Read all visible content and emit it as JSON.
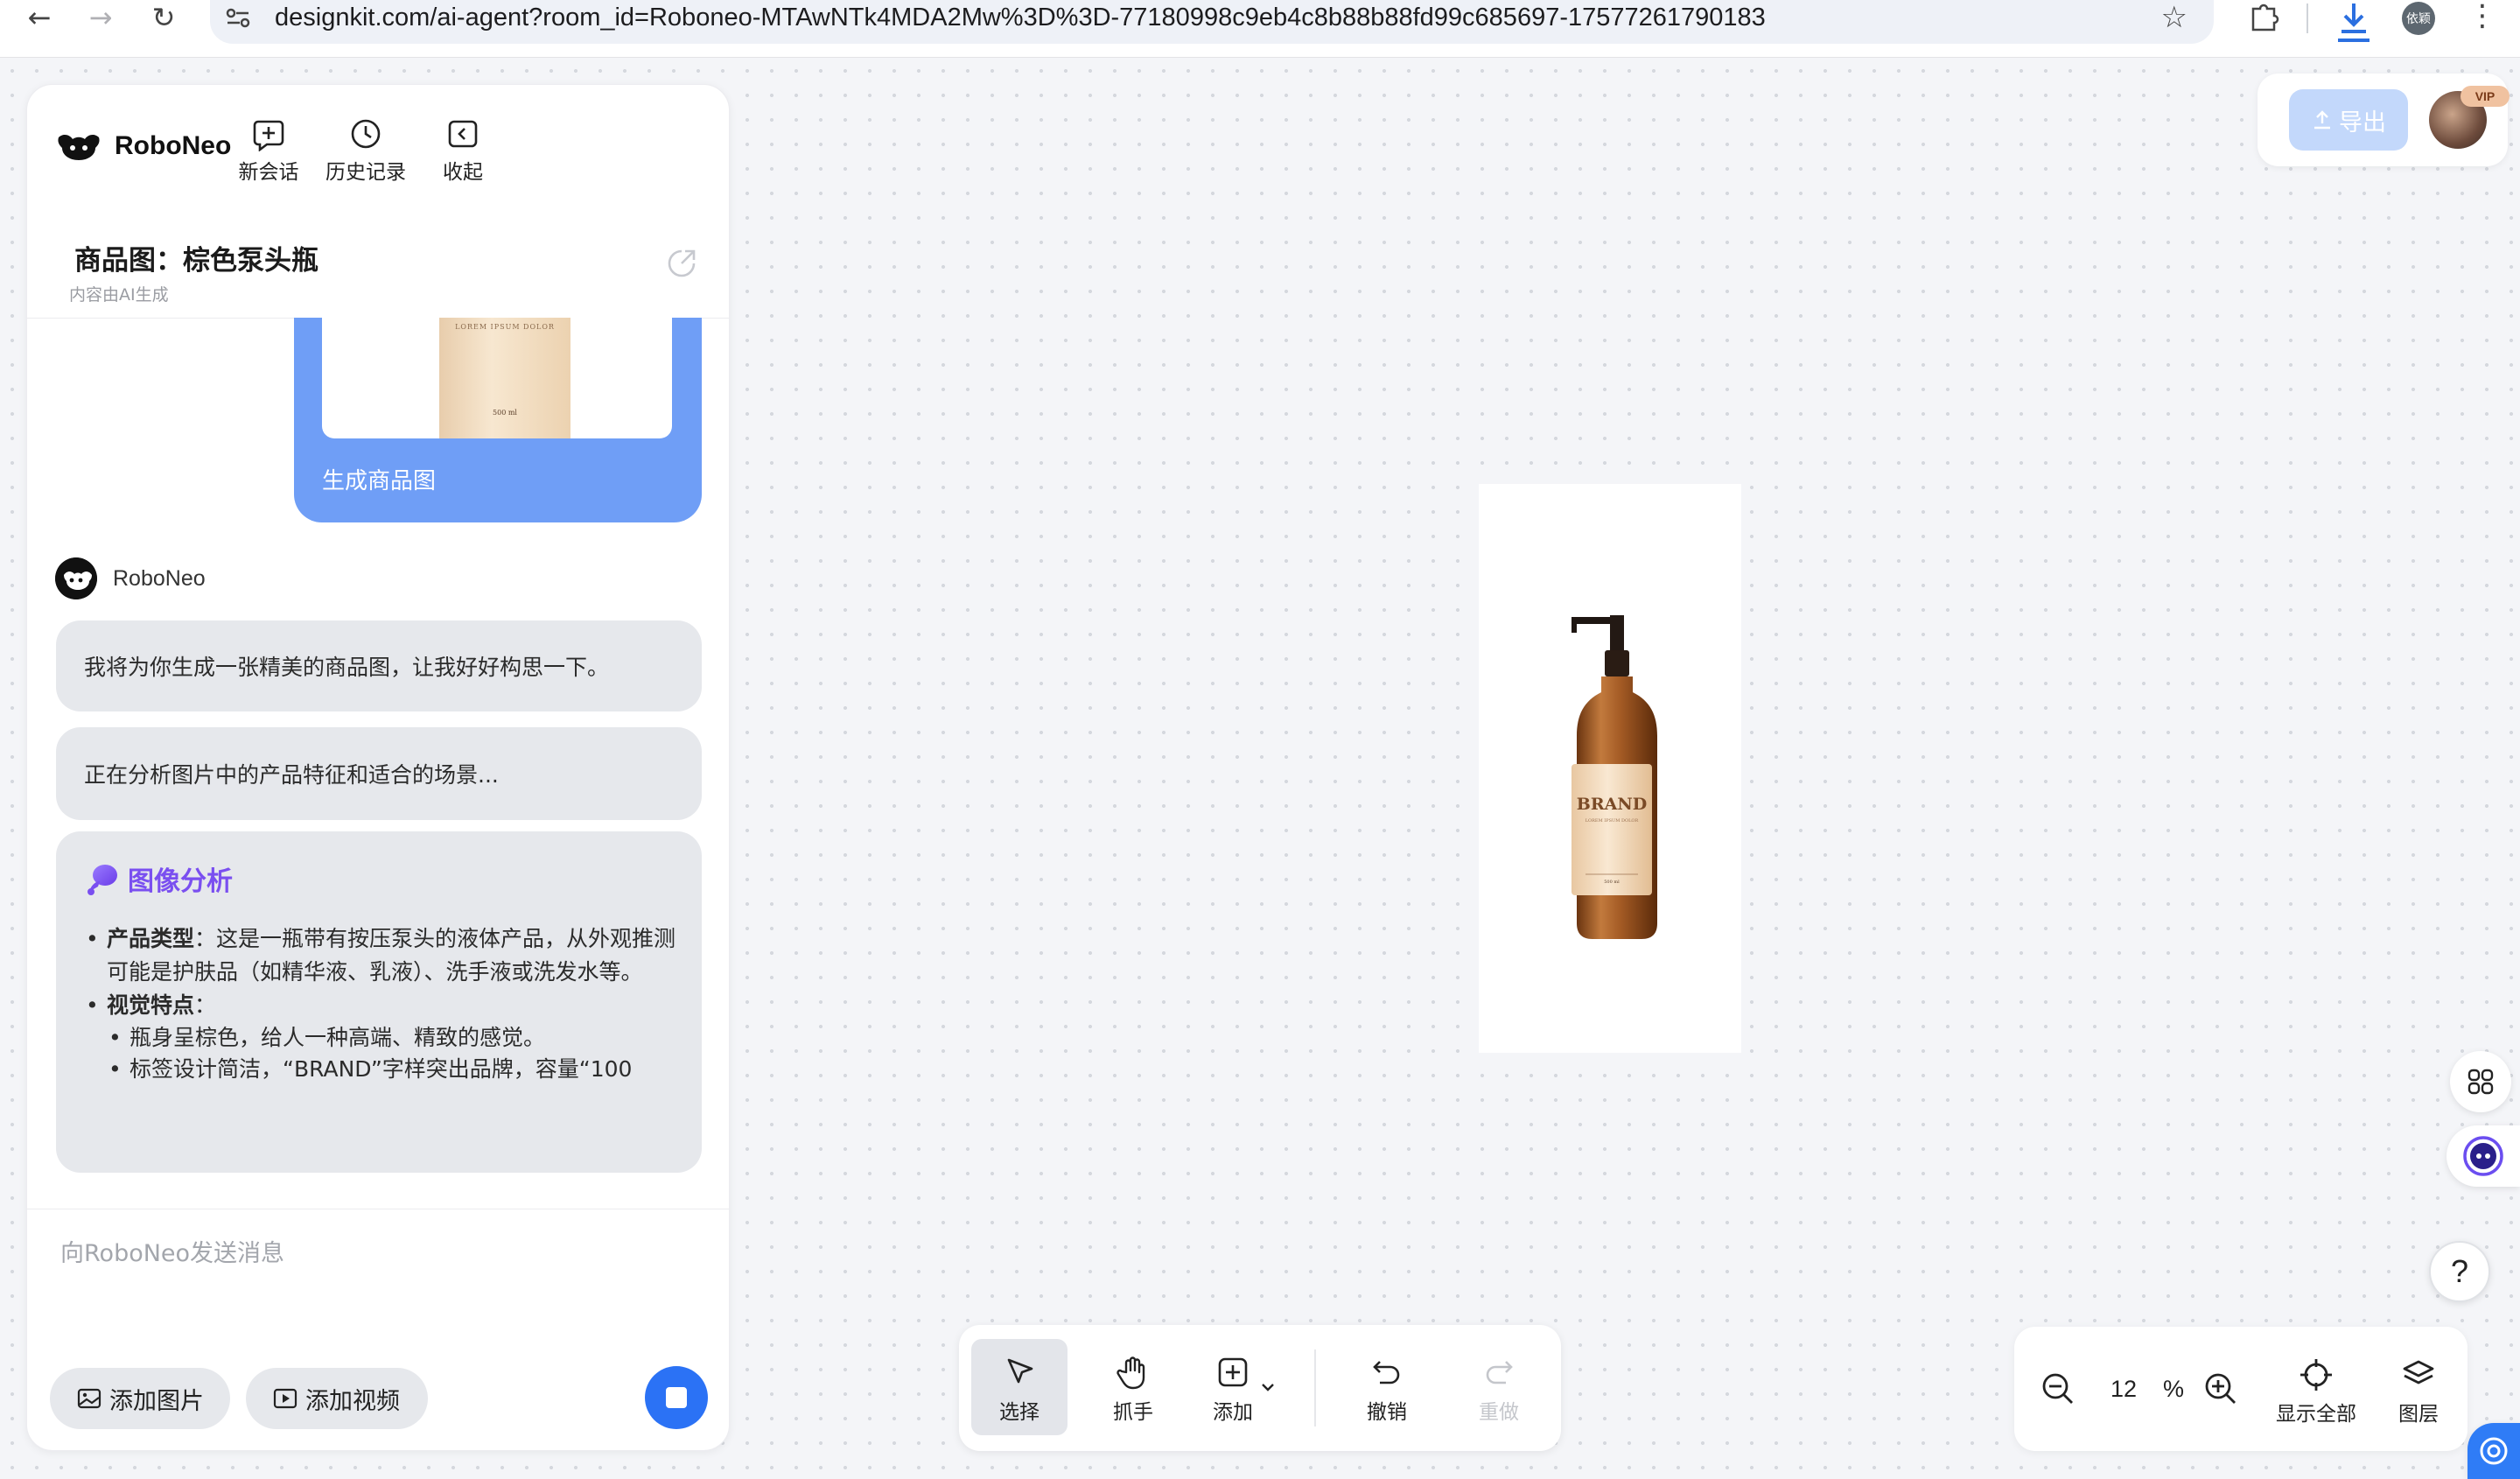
{
  "browser": {
    "url": "designkit.com/ai-agent?room_id=Roboneo-MTAwNTk4MDA2Mw%3D%3D-77180998c9eb4c8b88b88fd99c685697-17577261790183",
    "profile_name": "依颖"
  },
  "app": {
    "logo_text": "RoboNeo",
    "header_buttons": [
      {
        "label": "新会话",
        "icon": "new-chat-icon"
      },
      {
        "label": "历史记录",
        "icon": "history-clock-icon"
      },
      {
        "label": "收起",
        "icon": "collapse-icon"
      }
    ]
  },
  "conversation": {
    "title": "商品图：棕色泵头瓶",
    "subtitle": "内容由AI生成",
    "user_card": {
      "caption": "生成商品图",
      "thumb_label_top": "LOREM IPSUM DOLOR",
      "thumb_label_bottom": "500 ml"
    },
    "agent_name": "RoboNeo",
    "messages": [
      "我将为你生成一张精美的商品图，让我好好构思一下。",
      "正在分析图片中的产品特征和适合的场景..."
    ],
    "analysis": {
      "title": "图像分析",
      "item1_label": "产品类型",
      "item1_text": "：这是一瓶带有按压泵头的液体产品，从外观推测可能是护肤品（如精华液、乳液）、洗手液或洗发水等。",
      "item2_label": "视觉特点",
      "item2_text": "：",
      "sub1": "瓶身呈棕色，给人一种高端、精致的感觉。",
      "sub2": "标签设计简洁，“BRAND”字样突出品牌，容量“100"
    },
    "input_placeholder": "向RoboNeo发送消息",
    "add_image_label": "添加图片",
    "add_video_label": "添加视频"
  },
  "canvas": {
    "product_brand": "BRAND",
    "product_subtext": "LOREM IPSUM DOLOR",
    "product_volume": "500 ml"
  },
  "topright": {
    "export_label": "导出",
    "vip_badge": "VIP"
  },
  "toolbar": {
    "select": "选择",
    "hand": "抓手",
    "add": "添加",
    "undo": "撤销",
    "redo": "重做"
  },
  "zoom": {
    "value": "12",
    "unit": "%",
    "fit_all": "显示全部",
    "layers": "图层"
  },
  "help_label": "?",
  "colors": {
    "accent_blue": "#2b72f5",
    "user_card_blue": "#6f9ef6",
    "analysis_purple": "#7a4ff0",
    "bubble_gray": "#e6e8ec"
  }
}
